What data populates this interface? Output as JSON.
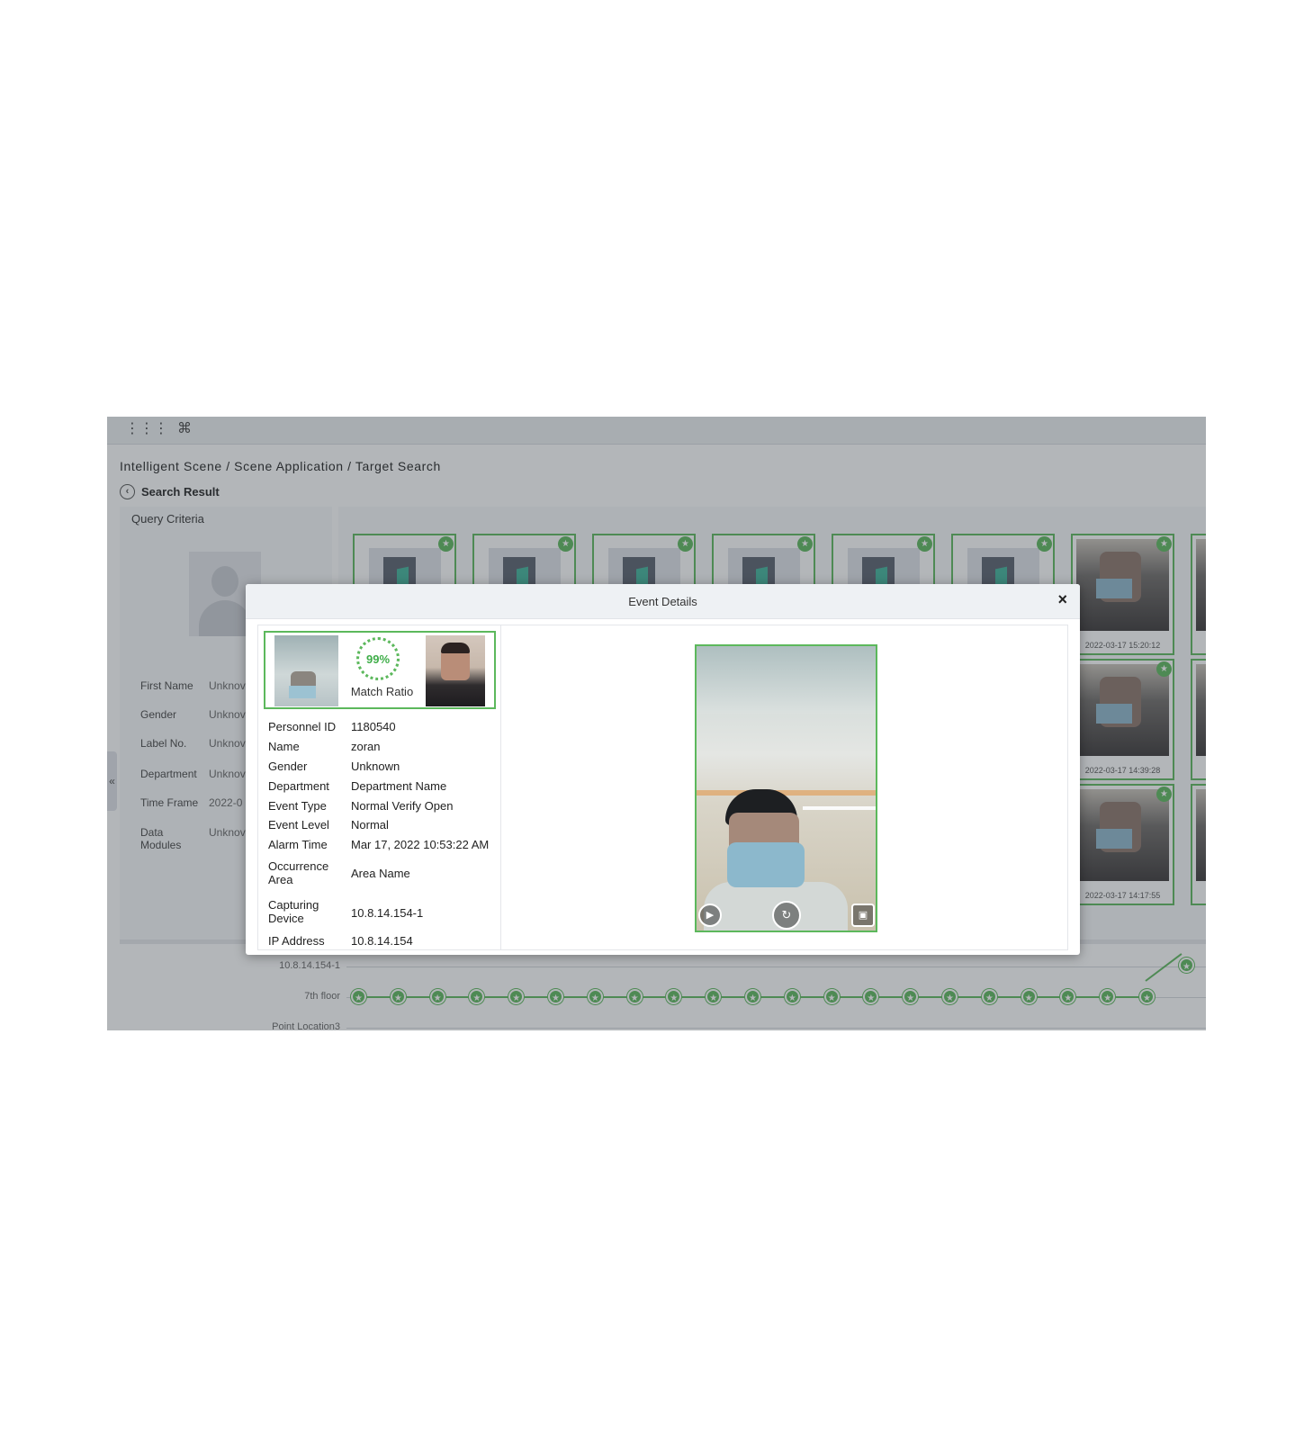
{
  "breadcrumb": "Intelligent Scene / Scene Application / Target Search",
  "back_label": "Search Result",
  "query": {
    "title": "Query Criteria",
    "rows": [
      {
        "label": "First Name",
        "value": "Unknov"
      },
      {
        "label": "Gender",
        "value": "Unknov"
      },
      {
        "label": "Label No.",
        "value": "Unknov"
      },
      {
        "label": "Department",
        "value": "Unknov"
      },
      {
        "label": "Time Frame",
        "value": "2022-0"
      },
      {
        "label": "Data Modules",
        "value": "Unknov"
      }
    ]
  },
  "results": {
    "timestamps": [
      "2022-03-17 15:20:12",
      "2022-03-17 14:39:28",
      "2022-03-17 14:17:55"
    ]
  },
  "timeline": {
    "labels": [
      "10.8.14.154-1",
      "7th floor",
      "Point Location3"
    ]
  },
  "modal": {
    "title": "Event Details",
    "close_label": "×",
    "match": {
      "ratio": "99%",
      "label": "Match Ratio"
    },
    "info": [
      {
        "label": "Personnel ID",
        "value": "1180540"
      },
      {
        "label": "Name",
        "value": "zoran"
      },
      {
        "label": "Gender",
        "value": "Unknown"
      },
      {
        "label": "Department",
        "value": "Department Name"
      },
      {
        "label": "Event Type",
        "value": "Normal Verify Open"
      },
      {
        "label": "Event Level",
        "value": "Normal"
      },
      {
        "label": "Alarm Time",
        "value": "Mar 17, 2022 10:53:22 AM"
      },
      {
        "label": "Occurrence Area",
        "value": "Area Name"
      },
      {
        "label": "Capturing Device",
        "value": "10.8.14.154-1"
      },
      {
        "label": "IP Address",
        "value": "10.8.14.154"
      }
    ]
  },
  "icons": {
    "apps": "apps-grid-icon",
    "command": "command-icon",
    "back": "back-arrow-icon",
    "star": "star-badge-icon",
    "play": "play-icon",
    "replay": "replay-icon",
    "snapshot": "snapshot-icon"
  },
  "colors": {
    "accent_green": "#5cb85c",
    "overlay": "rgba(55,62,72,0.38)"
  }
}
